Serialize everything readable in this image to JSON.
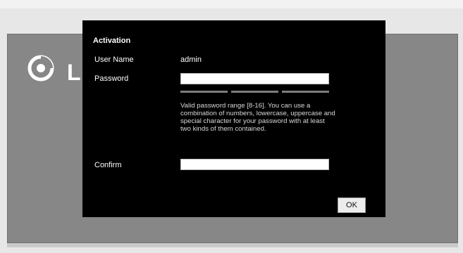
{
  "dialog": {
    "title": "Activation",
    "username_label": "User Name",
    "username_value": "admin",
    "password_label": "Password",
    "password_value": "",
    "password_hint": "Valid password range [8-16]. You can use a combination of numbers, lowercase, uppercase and special character for your password with at least two kinds of them contained.",
    "confirm_label": "Confirm",
    "confirm_value": "",
    "ok_label": "OK"
  },
  "background": {
    "logo_letter": "L"
  },
  "icons": {
    "logo": "logo-icon"
  },
  "colors": {
    "modal_bg": "#000000",
    "page_panel": "#878787",
    "page_bg": "#e7e7e7"
  }
}
